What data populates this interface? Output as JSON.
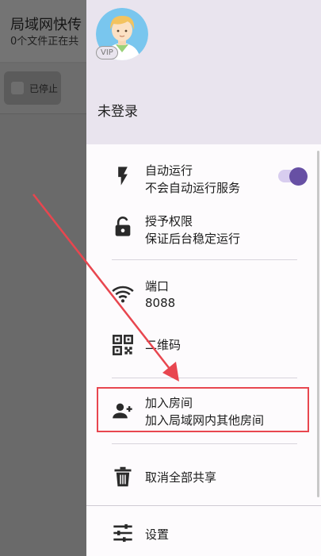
{
  "background_app": {
    "title": "局域网快传",
    "subtitle": "0个文件正在共",
    "stopped_label": "已停止"
  },
  "drawer": {
    "vip_badge": "VIP",
    "username": "未登录",
    "items": [
      {
        "label": "自动运行",
        "sub": "不会自动运行服务",
        "icon": "lightning-icon",
        "toggle_on": true
      },
      {
        "label": "授予权限",
        "sub": "保证后台稳定运行",
        "icon": "unlock-icon"
      },
      {
        "label": "端口",
        "sub": "8088",
        "icon": "wifi-icon"
      },
      {
        "label": "二维码",
        "icon": "qr-code-icon"
      },
      {
        "label": "加入房间",
        "sub": "加入局域网内其他房间",
        "icon": "person-add-icon"
      },
      {
        "label": "取消全部共享",
        "icon": "trash-icon"
      },
      {
        "label": "设置",
        "icon": "settings-sliders-icon"
      }
    ]
  },
  "colors": {
    "accent": "#6750a4",
    "annotation_red": "#e8464f",
    "drawer_header": "#e9e4ee",
    "scrim": "#6a6a6a"
  }
}
